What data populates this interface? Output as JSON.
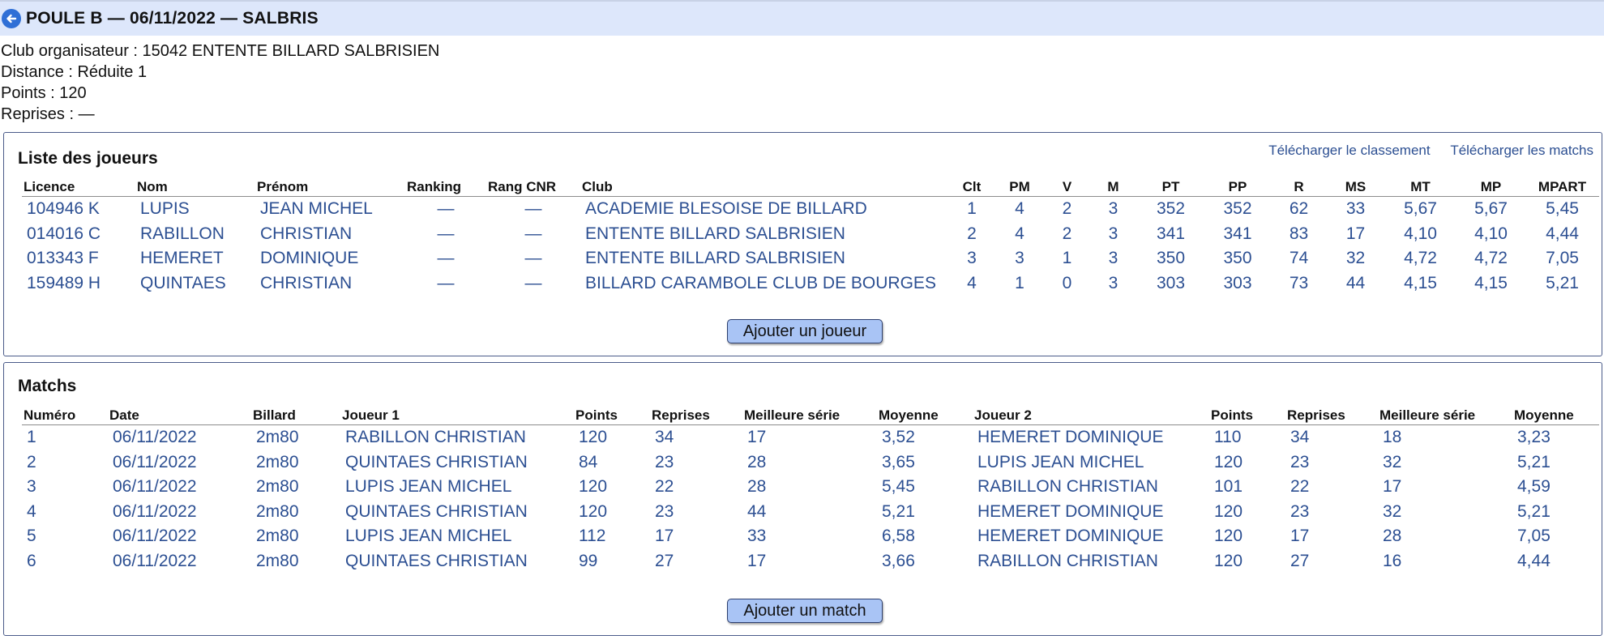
{
  "header": {
    "title": "POULE B — 06/11/2022 — SALBRIS",
    "back_icon": "arrow-left-circle-icon",
    "colors": {
      "bar": "#dde7fb",
      "icon": "#2f6fd6"
    }
  },
  "info": {
    "club": "Club organisateur : 15042 ENTENTE BILLARD SALBRISIEN",
    "distance": "Distance : Réduite 1",
    "points": "Points : 120",
    "reprises": "Reprises : —"
  },
  "players": {
    "title": "Liste des joueurs",
    "download_ranking": "Télécharger le classement",
    "download_matches": "Télécharger les matchs",
    "columns": [
      "Licence",
      "Nom",
      "Prénom",
      "Ranking",
      "Rang CNR",
      "Club",
      "Clt",
      "PM",
      "V",
      "M",
      "PT",
      "PP",
      "R",
      "MS",
      "MT",
      "MP",
      "MPART"
    ],
    "rows": [
      [
        "104946 K",
        "LUPIS",
        "JEAN MICHEL",
        "—",
        "—",
        "ACADEMIE BLESOISE DE BILLARD",
        "1",
        "4",
        "2",
        "3",
        "352",
        "352",
        "62",
        "33",
        "5,67",
        "5,67",
        "5,45"
      ],
      [
        "014016 C",
        "RABILLON",
        "CHRISTIAN",
        "—",
        "—",
        "ENTENTE BILLARD SALBRISIEN",
        "2",
        "4",
        "2",
        "3",
        "341",
        "341",
        "83",
        "17",
        "4,10",
        "4,10",
        "4,44"
      ],
      [
        "013343 F",
        "HEMERET",
        "DOMINIQUE",
        "—",
        "—",
        "ENTENTE BILLARD SALBRISIEN",
        "3",
        "3",
        "1",
        "3",
        "350",
        "350",
        "74",
        "32",
        "4,72",
        "4,72",
        "7,05"
      ],
      [
        "159489 H",
        "QUINTAES",
        "CHRISTIAN",
        "—",
        "—",
        "BILLARD CARAMBOLE CLUB DE BOURGES",
        "4",
        "1",
        "0",
        "3",
        "303",
        "303",
        "73",
        "44",
        "4,15",
        "4,15",
        "5,21"
      ]
    ],
    "add_button": "Ajouter un joueur"
  },
  "matches": {
    "title": "Matchs",
    "columns": [
      "Numéro",
      "Date",
      "Billard",
      "Joueur 1",
      "Points",
      "Reprises",
      "Meilleure série",
      "Moyenne",
      "Joueur 2",
      "Points",
      "Reprises",
      "Meilleure série",
      "Moyenne"
    ],
    "rows": [
      [
        "1",
        "06/11/2022",
        "2m80",
        "RABILLON CHRISTIAN",
        "120",
        "34",
        "17",
        "3,52",
        "HEMERET DOMINIQUE",
        "110",
        "34",
        "18",
        "3,23"
      ],
      [
        "2",
        "06/11/2022",
        "2m80",
        "QUINTAES CHRISTIAN",
        "84",
        "23",
        "28",
        "3,65",
        "LUPIS JEAN MICHEL",
        "120",
        "23",
        "32",
        "5,21"
      ],
      [
        "3",
        "06/11/2022",
        "2m80",
        "LUPIS JEAN MICHEL",
        "120",
        "22",
        "28",
        "5,45",
        "RABILLON CHRISTIAN",
        "101",
        "22",
        "17",
        "4,59"
      ],
      [
        "4",
        "06/11/2022",
        "2m80",
        "QUINTAES CHRISTIAN",
        "120",
        "23",
        "44",
        "5,21",
        "HEMERET DOMINIQUE",
        "120",
        "23",
        "32",
        "5,21"
      ],
      [
        "5",
        "06/11/2022",
        "2m80",
        "LUPIS JEAN MICHEL",
        "112",
        "17",
        "33",
        "6,58",
        "HEMERET DOMINIQUE",
        "120",
        "17",
        "28",
        "7,05"
      ],
      [
        "6",
        "06/11/2022",
        "2m80",
        "QUINTAES CHRISTIAN",
        "99",
        "27",
        "17",
        "3,66",
        "RABILLON CHRISTIAN",
        "120",
        "27",
        "16",
        "4,44"
      ]
    ],
    "add_button": "Ajouter un match"
  },
  "colors": {
    "link": "#2c4f92",
    "button": "#a9c4f5",
    "border": "#4a5b89"
  }
}
